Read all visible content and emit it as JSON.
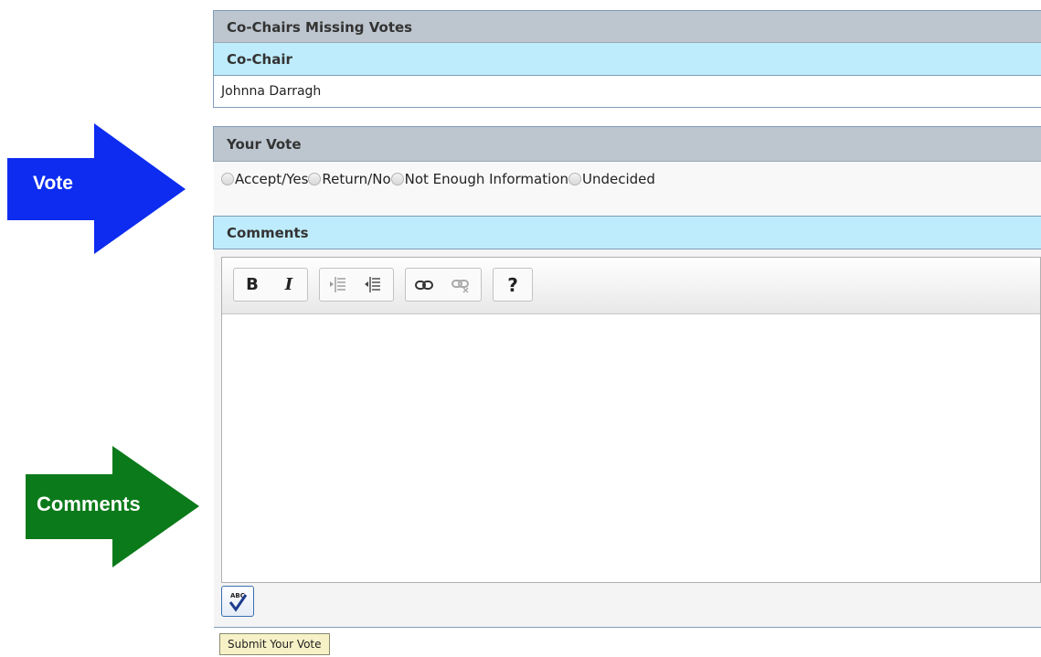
{
  "missing_votes": {
    "title": "Co-Chairs Missing Votes",
    "column_header": "Co-Chair",
    "rows": [
      "Johnna Darragh"
    ]
  },
  "vote": {
    "title": "Your Vote",
    "options": [
      "Accept/Yes",
      "Return/No",
      "Not Enough Information",
      "Undecided"
    ]
  },
  "comments": {
    "title": "Comments"
  },
  "toolbar": {
    "bold": "B",
    "italic": "I",
    "help": "?"
  },
  "annotations": {
    "vote_arrow_label": "Vote",
    "vote_arrow_color": "#0d2cf0",
    "comments_arrow_label": "Comments",
    "comments_arrow_color": "#0b7a1a"
  },
  "submit": {
    "label": "Submit Your Vote"
  }
}
